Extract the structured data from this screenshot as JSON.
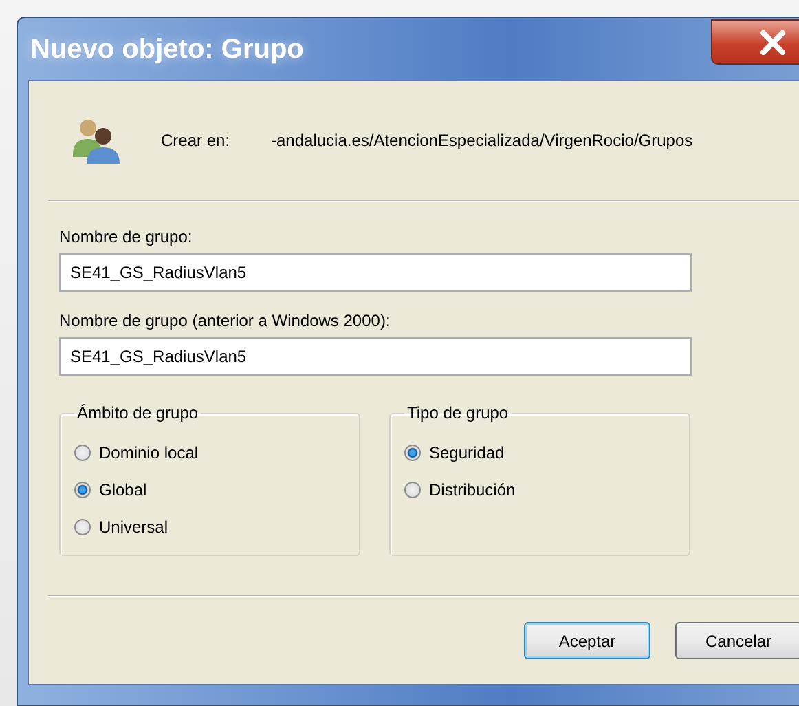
{
  "window": {
    "title": "Nuevo objeto: Grupo"
  },
  "location": {
    "label": "Crear en:",
    "path": "-andalucia.es/AtencionEspecializada/VirgenRocio/Grupos"
  },
  "fields": [
    {
      "label": "Nombre de grupo:",
      "value": "SE41_GS_RadiusVlan5"
    },
    {
      "label": "Nombre de grupo (anterior a Windows 2000):",
      "value": "SE41_GS_RadiusVlan5"
    }
  ],
  "groups": [
    {
      "title": "Ámbito de grupo",
      "options": [
        {
          "label": "Dominio local",
          "selected": false
        },
        {
          "label": "Global",
          "selected": true
        },
        {
          "label": "Universal",
          "selected": false
        }
      ]
    },
    {
      "title": "Tipo de grupo",
      "options": [
        {
          "label": "Seguridad",
          "selected": true
        },
        {
          "label": "Distribución",
          "selected": false
        }
      ]
    }
  ],
  "buttons": [
    {
      "label": "Aceptar",
      "default": true
    },
    {
      "label": "Cancelar",
      "default": false
    }
  ]
}
